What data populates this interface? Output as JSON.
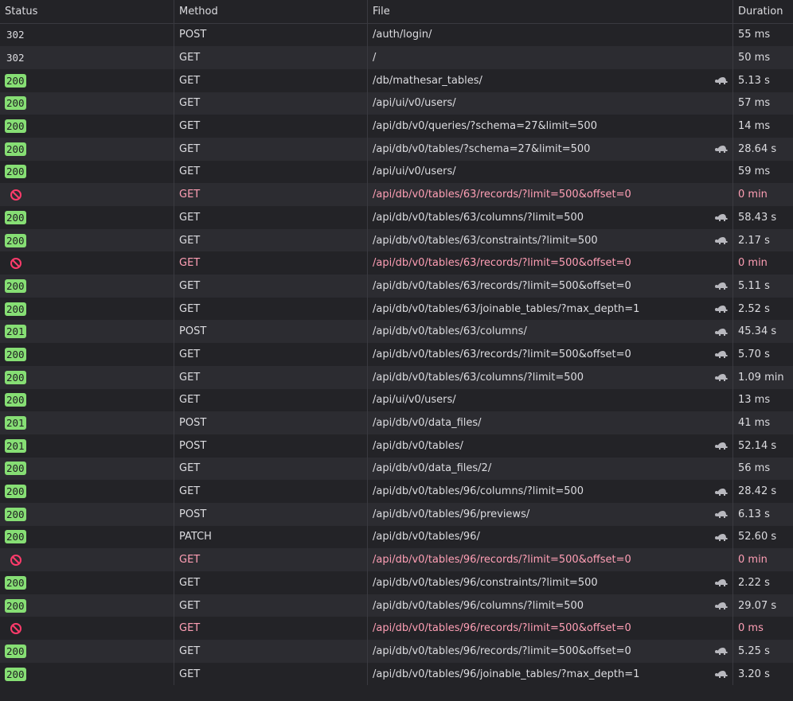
{
  "columns": {
    "status": "Status",
    "method": "Method",
    "file": "File",
    "duration": "Duration"
  },
  "colors": {
    "ok_badge": "#86de74",
    "blocked_text": "#ff9fb5",
    "blocked_icon": "#ff3b6b",
    "slow_icon": "#b8b8be"
  },
  "requests": [
    {
      "status": "302",
      "method": "POST",
      "file": "/auth/login/",
      "duration": "55 ms",
      "slow": false,
      "blocked": false
    },
    {
      "status": "302",
      "method": "GET",
      "file": "/",
      "duration": "50 ms",
      "slow": false,
      "blocked": false
    },
    {
      "status": "200",
      "method": "GET",
      "file": "/db/mathesar_tables/",
      "duration": "5.13 s",
      "slow": true,
      "blocked": false
    },
    {
      "status": "200",
      "method": "GET",
      "file": "/api/ui/v0/users/",
      "duration": "57 ms",
      "slow": false,
      "blocked": false
    },
    {
      "status": "200",
      "method": "GET",
      "file": "/api/db/v0/queries/?schema=27&limit=500",
      "duration": "14 ms",
      "slow": false,
      "blocked": false
    },
    {
      "status": "200",
      "method": "GET",
      "file": "/api/db/v0/tables/?schema=27&limit=500",
      "duration": "28.64 s",
      "slow": true,
      "blocked": false
    },
    {
      "status": "200",
      "method": "GET",
      "file": "/api/ui/v0/users/",
      "duration": "59 ms",
      "slow": false,
      "blocked": false
    },
    {
      "status": "",
      "method": "GET",
      "file": "/api/db/v0/tables/63/records/?limit=500&offset=0",
      "duration": "0 min",
      "slow": false,
      "blocked": true
    },
    {
      "status": "200",
      "method": "GET",
      "file": "/api/db/v0/tables/63/columns/?limit=500",
      "duration": "58.43 s",
      "slow": true,
      "blocked": false
    },
    {
      "status": "200",
      "method": "GET",
      "file": "/api/db/v0/tables/63/constraints/?limit=500",
      "duration": "2.17 s",
      "slow": true,
      "blocked": false
    },
    {
      "status": "",
      "method": "GET",
      "file": "/api/db/v0/tables/63/records/?limit=500&offset=0",
      "duration": "0 min",
      "slow": false,
      "blocked": true
    },
    {
      "status": "200",
      "method": "GET",
      "file": "/api/db/v0/tables/63/records/?limit=500&offset=0",
      "duration": "5.11 s",
      "slow": true,
      "blocked": false
    },
    {
      "status": "200",
      "method": "GET",
      "file": "/api/db/v0/tables/63/joinable_tables/?max_depth=1",
      "duration": "2.52 s",
      "slow": true,
      "blocked": false
    },
    {
      "status": "201",
      "method": "POST",
      "file": "/api/db/v0/tables/63/columns/",
      "duration": "45.34 s",
      "slow": true,
      "blocked": false
    },
    {
      "status": "200",
      "method": "GET",
      "file": "/api/db/v0/tables/63/records/?limit=500&offset=0",
      "duration": "5.70 s",
      "slow": true,
      "blocked": false
    },
    {
      "status": "200",
      "method": "GET",
      "file": "/api/db/v0/tables/63/columns/?limit=500",
      "duration": "1.09 min",
      "slow": true,
      "blocked": false
    },
    {
      "status": "200",
      "method": "GET",
      "file": "/api/ui/v0/users/",
      "duration": "13 ms",
      "slow": false,
      "blocked": false
    },
    {
      "status": "201",
      "method": "POST",
      "file": "/api/db/v0/data_files/",
      "duration": "41 ms",
      "slow": false,
      "blocked": false
    },
    {
      "status": "201",
      "method": "POST",
      "file": "/api/db/v0/tables/",
      "duration": "52.14 s",
      "slow": true,
      "blocked": false
    },
    {
      "status": "200",
      "method": "GET",
      "file": "/api/db/v0/data_files/2/",
      "duration": "56 ms",
      "slow": false,
      "blocked": false
    },
    {
      "status": "200",
      "method": "GET",
      "file": "/api/db/v0/tables/96/columns/?limit=500",
      "duration": "28.42 s",
      "slow": true,
      "blocked": false
    },
    {
      "status": "200",
      "method": "POST",
      "file": "/api/db/v0/tables/96/previews/",
      "duration": "6.13 s",
      "slow": true,
      "blocked": false
    },
    {
      "status": "200",
      "method": "PATCH",
      "file": "/api/db/v0/tables/96/",
      "duration": "52.60 s",
      "slow": true,
      "blocked": false
    },
    {
      "status": "",
      "method": "GET",
      "file": "/api/db/v0/tables/96/records/?limit=500&offset=0",
      "duration": "0 min",
      "slow": false,
      "blocked": true
    },
    {
      "status": "200",
      "method": "GET",
      "file": "/api/db/v0/tables/96/constraints/?limit=500",
      "duration": "2.22 s",
      "slow": true,
      "blocked": false
    },
    {
      "status": "200",
      "method": "GET",
      "file": "/api/db/v0/tables/96/columns/?limit=500",
      "duration": "29.07 s",
      "slow": true,
      "blocked": false
    },
    {
      "status": "",
      "method": "GET",
      "file": "/api/db/v0/tables/96/records/?limit=500&offset=0",
      "duration": "0 ms",
      "slow": false,
      "blocked": true
    },
    {
      "status": "200",
      "method": "GET",
      "file": "/api/db/v0/tables/96/records/?limit=500&offset=0",
      "duration": "5.25 s",
      "slow": true,
      "blocked": false
    },
    {
      "status": "200",
      "method": "GET",
      "file": "/api/db/v0/tables/96/joinable_tables/?max_depth=1",
      "duration": "3.20 s",
      "slow": true,
      "blocked": false
    }
  ]
}
